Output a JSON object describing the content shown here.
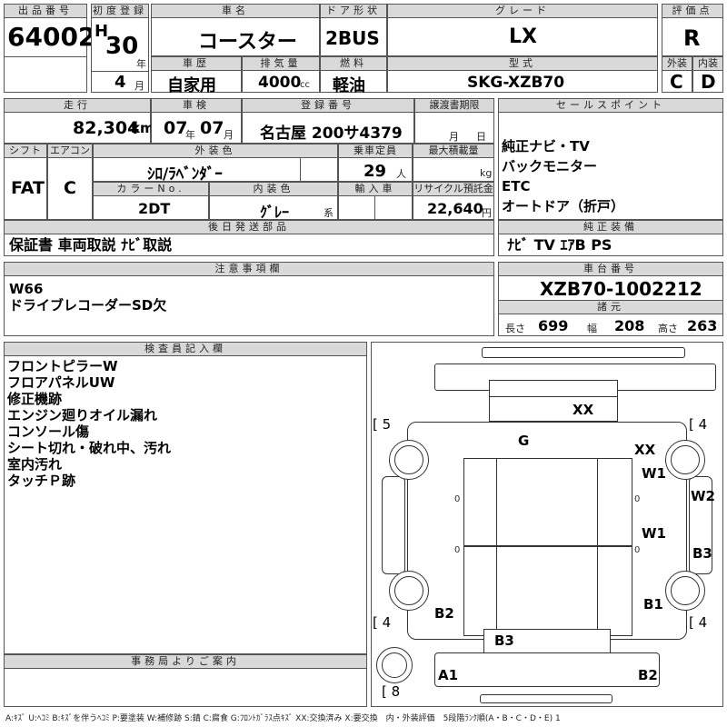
{
  "header_labels": {
    "lot_no": "出品番号",
    "first_reg": "初度登録",
    "car_name": "車名",
    "door": "ドア形状",
    "grade": "グレード",
    "score": "評価点",
    "history": "車歴",
    "displacement": "排気量",
    "fuel": "燃料",
    "model": "型式",
    "exterior": "外装",
    "interior": "内装"
  },
  "lot_no": "64002",
  "first_reg": {
    "era": "H",
    "year": "30",
    "year_unit": "年",
    "month": "4",
    "month_unit": "月"
  },
  "car_name": "コースター",
  "door": "2BUS",
  "grade": "LX",
  "score": "R",
  "history": "自家用",
  "displacement": {
    "value": "4000",
    "unit": "cc"
  },
  "fuel": "軽油",
  "model": "SKG-XZB70",
  "exterior_score": "C",
  "interior_score": "D",
  "row2_labels": {
    "mileage": "走行",
    "inspection": "車検",
    "plate": "登録番号",
    "transfer_deadline": "譲渡書期限",
    "sales_point": "セールスポイント"
  },
  "mileage": {
    "value": "82,304",
    "unit": "km"
  },
  "inspection": {
    "year": "07",
    "year_unit": "年",
    "month": "07",
    "month_unit": "月"
  },
  "plate": "名古屋 200サ4379",
  "transfer_deadline": {
    "month_unit": "月",
    "day_unit": "日"
  },
  "sales_points": [
    "純正ナビ・TV",
    "バックモニター",
    "ETC",
    "オートドア（折戸）"
  ],
  "row3_labels": {
    "shift": "シフト",
    "ac": "エアコン",
    "ext_color": "外装色",
    "capacity": "乗車定員",
    "max_load": "最大積載量",
    "color_no": "カラーNo.",
    "int_color": "内装色",
    "import": "輸入車",
    "recycle": "リサイクル預託金"
  },
  "shift": "FAT",
  "ac": "C",
  "ext_color": "ｼﾛ/ﾗﾍﾞﾝﾀﾞｰ",
  "capacity": {
    "value": "29",
    "unit": "人"
  },
  "max_load_unit": "kg",
  "color_no": "2DT",
  "int_color": {
    "value": "ｸﾞﾚｰ",
    "unit": "系"
  },
  "recycle": {
    "value": "22,640",
    "unit": "円"
  },
  "later_parts": {
    "label": "後日発送部品",
    "text": "保証書 車両取説 ﾅﾋﾞ取説"
  },
  "genuine_equipment": {
    "label": "純正装備",
    "text": "ﾅﾋﾞ TV ｴｱB PS"
  },
  "notes": {
    "label": "注意事項欄",
    "lines": [
      "W66",
      "ドライブレコーダーSD欠"
    ]
  },
  "chassis": {
    "label": "車台番号",
    "value": "XZB70-1002212"
  },
  "specs": {
    "label": "諸元",
    "length_label": "長さ",
    "length": "699",
    "width_label": "幅",
    "width": "208",
    "height_label": "高さ",
    "height": "263"
  },
  "inspector": {
    "label": "検査員記入欄",
    "lines": [
      "フロントピラーW",
      "フロアパネルUW",
      "修正機跡",
      "エンジン廻りオイル漏れ",
      "コンソール傷",
      "シート切れ・破れ中、汚れ",
      "室内汚れ",
      "タッチＰ跡"
    ]
  },
  "office": {
    "label": "事務局よりご案内"
  },
  "diagram": {
    "tire_fl": "[ 5",
    "tire_fr": "[ 4",
    "tire_rl": "[ 4",
    "tire_rr": "[ 4",
    "spare": "[ 8",
    "marks": {
      "roof": "XX",
      "center": "G",
      "front_right_top": "XX",
      "right_w1": "W1",
      "right_side_w2": "W2",
      "right_side_b3": "B3",
      "right_mid_w1": "W1",
      "right_rear_b1": "B1",
      "left_rear_b2": "B2",
      "rear_b3": "B3",
      "rear_a1": "A1",
      "rear_b2": "B2"
    },
    "zero": "0"
  },
  "legend": "A:ｷｽﾞ U:ﾍｺﾐ B:ｷｽﾞを伴うﾍｺﾐ P:要塗装 W:補修跡 S:錆 C:腐食 G:ﾌﾛﾝﾄｶﾞﾗｽ点ｷｽﾞ XX:交換済み X:要交換　内・外装評価　5段階ﾗﾝｸ順(A・B・C・D・E) 1"
}
